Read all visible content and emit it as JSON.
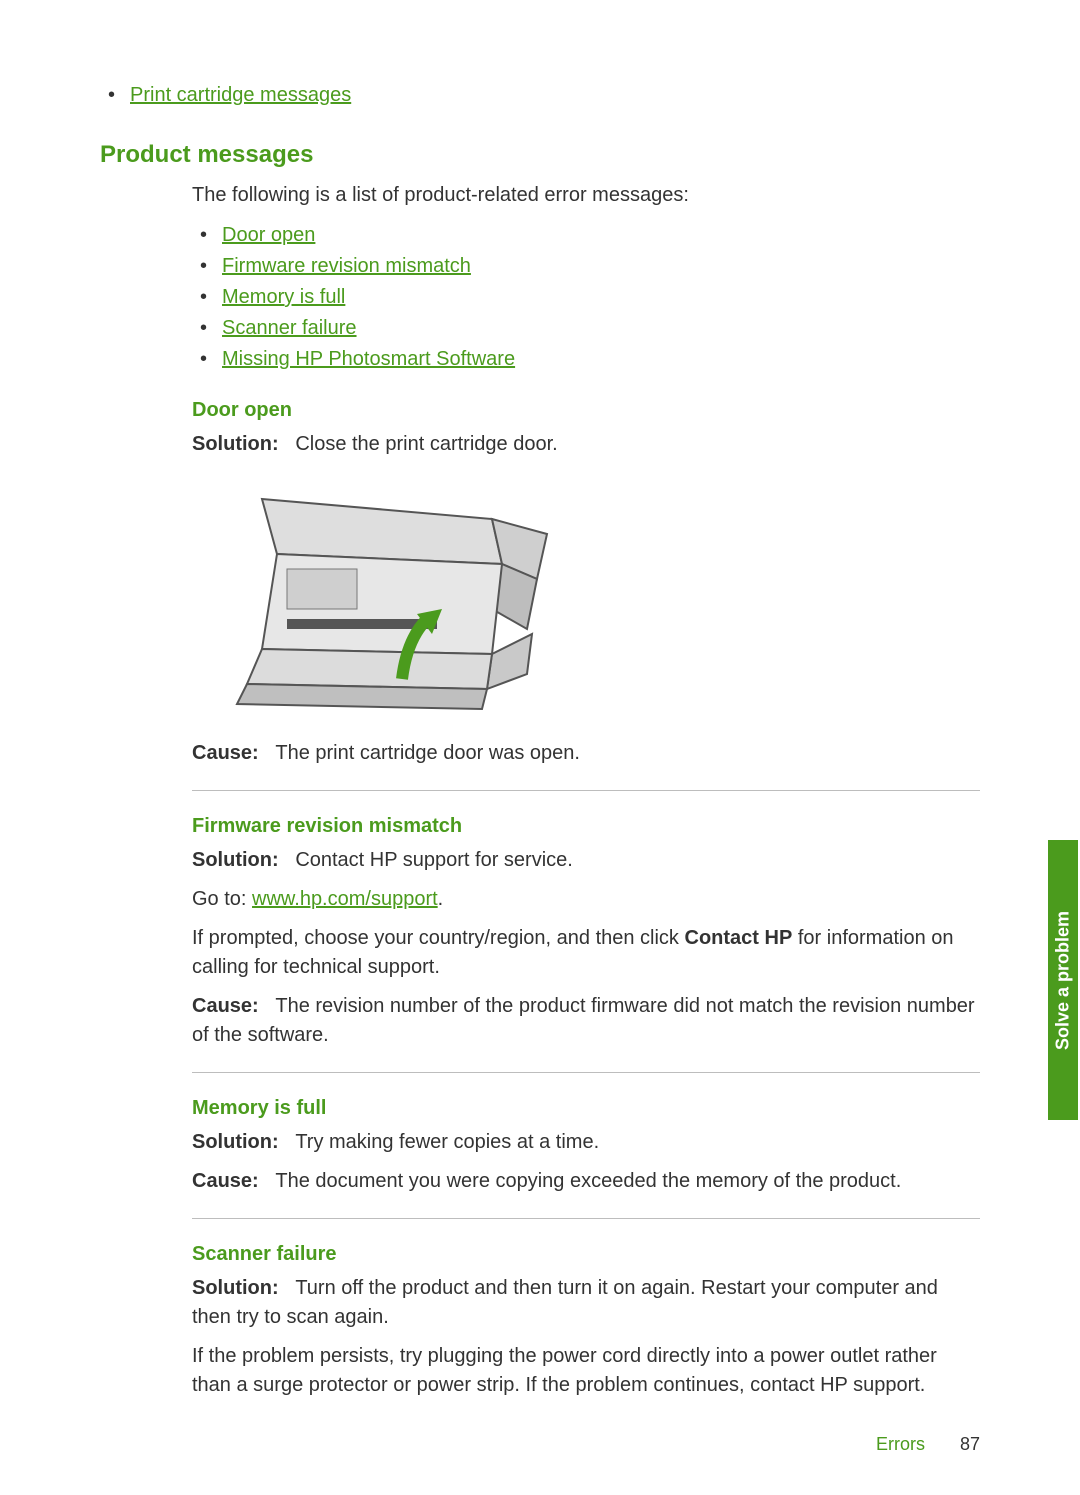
{
  "top_link": "Print cartridge messages",
  "product_messages": {
    "heading": "Product messages",
    "intro": "The following is a list of product-related error messages:",
    "links": [
      "Door open",
      "Firmware revision mismatch",
      "Memory is full",
      "Scanner failure",
      "Missing HP Photosmart Software"
    ]
  },
  "door_open": {
    "heading": "Door open",
    "solution_label": "Solution:",
    "solution_text": "Close the print cartridge door.",
    "cause_label": "Cause:",
    "cause_text": "The print cartridge door was open."
  },
  "firmware": {
    "heading": "Firmware revision mismatch",
    "solution_label": "Solution:",
    "solution_text": "Contact HP support for service.",
    "goto_prefix": "Go to: ",
    "goto_link": "www.hp.com/support",
    "goto_suffix": ".",
    "prompt_prefix": "If prompted, choose your country/region, and then click ",
    "prompt_bold": "Contact HP",
    "prompt_suffix": " for information on calling for technical support.",
    "cause_label": "Cause:",
    "cause_text": "The revision number of the product firmware did not match the revision number of the software."
  },
  "memory": {
    "heading": "Memory is full",
    "solution_label": "Solution:",
    "solution_text": "Try making fewer copies at a time.",
    "cause_label": "Cause:",
    "cause_text": "The document you were copying exceeded the memory of the product."
  },
  "scanner": {
    "heading": "Scanner failure",
    "solution_label": "Solution:",
    "solution_text": "Turn off the product and then turn it on again. Restart your computer and then try to scan again.",
    "persist_text": "If the problem persists, try plugging the power cord directly into a power outlet rather than a surge protector or power strip. If the problem continues, contact HP support."
  },
  "side_tab": "Solve a problem",
  "footer": {
    "section": "Errors",
    "page": "87"
  }
}
